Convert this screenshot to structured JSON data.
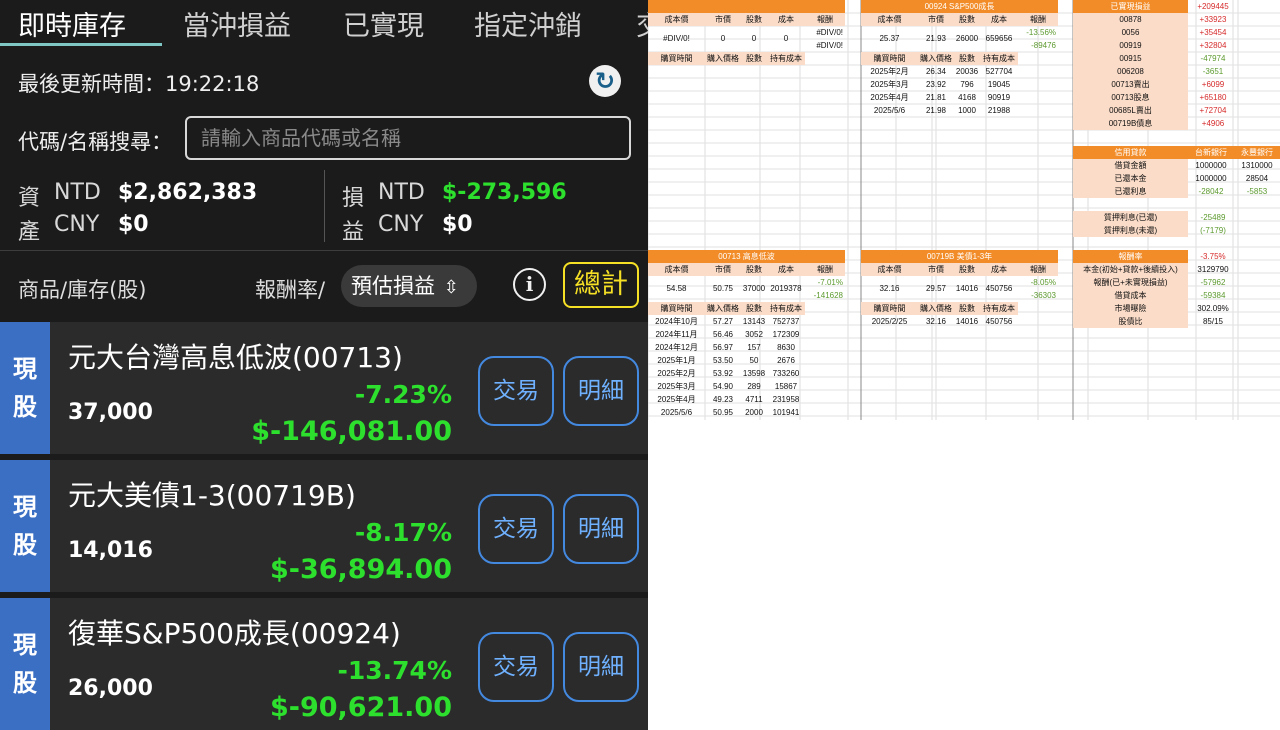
{
  "app": {
    "tabs": [
      "即時庫存",
      "當沖損益",
      "已實現",
      "指定沖銷",
      "交"
    ],
    "updated": "最後更新時間：19:22:18",
    "search_label": "代碼/名稱搜尋：",
    "search_placeholder": "請輸入商品代碼或名稱",
    "assets_label_1": "資",
    "assets_label_2": "產",
    "pl_label_1": "損",
    "pl_label_2": "益",
    "cur_ntd": "NTD",
    "cur_cny": "CNY",
    "assets_ntd": "$2,862,383",
    "assets_cny": "$0",
    "pl_ntd": "$-273,596",
    "pl_cny": "$0",
    "col_product": "商品/庫存(股)",
    "col_return": "報酬率/",
    "pill": "預估損益",
    "info": "i",
    "total": "總計",
    "trade": "交易",
    "detail": "明細",
    "badge_1": "現",
    "badge_2": "股",
    "holdings": [
      {
        "name": "元大台灣高息低波(00713)",
        "shares": "37,000",
        "pct": "-7.23%",
        "pnl": "$-146,081.00"
      },
      {
        "name": "元大美債1-3(00719B)",
        "shares": "14,016",
        "pct": "-8.17%",
        "pnl": "$-36,894.00"
      },
      {
        "name": "復華S&P500成長(00924)",
        "shares": "26,000",
        "pct": "-13.74%",
        "pnl": "$-90,621.00"
      }
    ],
    "colors": {
      "gain_green": "#2ee02e",
      "badge_blue": "#3b6fc4",
      "total_yellow": "#f5e026",
      "accent_orange": "#f28c28"
    }
  },
  "sheet": {
    "h": {
      "cost_price": "成本價",
      "mkt": "市價",
      "shares": "股數",
      "cost": "成本",
      "ret": "報酬",
      "buy_time": "購買時間",
      "buy_price": "購入價格",
      "hold_cost": "持有成本"
    },
    "blocks": {
      "b1": {
        "title": "",
        "cost_price": "#DIV/0!",
        "mkt": "0",
        "shares": "0",
        "cost": "0",
        "ret1": "#DIV/0!",
        "ret2": "#DIV/0!",
        "rows": []
      },
      "b2": {
        "title": "00924 S&P500成長",
        "cost_price": "25.37",
        "mkt": "21.93",
        "shares": "26000",
        "cost": "659656",
        "ret1": "-13.56%",
        "ret2": "-89476",
        "rows": [
          [
            "2025年2月",
            "26.34",
            "20036",
            "527704"
          ],
          [
            "2025年3月",
            "23.92",
            "796",
            "19045"
          ],
          [
            "2025年4月",
            "21.81",
            "4168",
            "90919"
          ],
          [
            "2025/5/6",
            "21.98",
            "1000",
            "21988"
          ]
        ]
      },
      "b3": {
        "title": "00713 高息低波",
        "cost_price": "54.58",
        "mkt": "50.75",
        "shares": "37000",
        "cost": "2019378",
        "ret1": "-7.01%",
        "ret2": "-141628",
        "rows": [
          [
            "2024年10月",
            "57.27",
            "13143",
            "752737"
          ],
          [
            "2024年11月",
            "56.46",
            "3052",
            "172309"
          ],
          [
            "2024年12月",
            "56.97",
            "157",
            "8630"
          ],
          [
            "2025年1月",
            "53.50",
            "50",
            "2676"
          ],
          [
            "2025年2月",
            "53.92",
            "13598",
            "733260"
          ],
          [
            "2025年3月",
            "54.90",
            "289",
            "15867"
          ],
          [
            "2025年4月",
            "49.23",
            "4711",
            "231958"
          ],
          [
            "2025/5/6",
            "50.95",
            "2000",
            "101941"
          ]
        ]
      },
      "b4": {
        "title": "00719B 美債1-3年",
        "cost_price": "32.16",
        "mkt": "29.57",
        "shares": "14016",
        "cost": "450756",
        "ret1": "-8.05%",
        "ret2": "-36303",
        "rows": [
          [
            "2025/2/25",
            "32.16",
            "14016",
            "450756"
          ]
        ]
      }
    },
    "realized": {
      "title": "已實現損益",
      "total": "+209445",
      "rows": [
        [
          "00878",
          "+33923"
        ],
        [
          "0056",
          "+35454"
        ],
        [
          "00919",
          "+32804"
        ],
        [
          "00915",
          "-47974"
        ],
        [
          "006208",
          "-3651"
        ],
        [
          "00713賣出",
          "+6099"
        ],
        [
          "00713股息",
          "+65180"
        ],
        [
          "00685L賣出",
          "+72704"
        ],
        [
          "00719B債息",
          "+4906"
        ]
      ]
    },
    "loan": {
      "title": "信用貸款",
      "bank1": "台新銀行",
      "bank2": "永豐銀行",
      "rows": [
        [
          "借貸金額",
          "1000000",
          "1310000"
        ],
        [
          "已還本金",
          "1000000",
          "28504"
        ],
        [
          "已還利息",
          "-28042",
          "-5853"
        ]
      ],
      "pledge": [
        [
          "質押利息(已還)",
          "-25489"
        ],
        [
          "質押利息(未還)",
          "(-7179)"
        ]
      ]
    },
    "summary": {
      "title": "報酬率",
      "title_val": "-3.75%",
      "rows": [
        [
          "本金(初始+貸款+後續投入)",
          "3129790"
        ],
        [
          "報酬(已+未實現損益)",
          "-57962"
        ],
        [
          "借貸成本",
          "-59384"
        ],
        [
          "市場曝險",
          "302.09%"
        ],
        [
          "股債比",
          "85/15"
        ]
      ]
    }
  }
}
